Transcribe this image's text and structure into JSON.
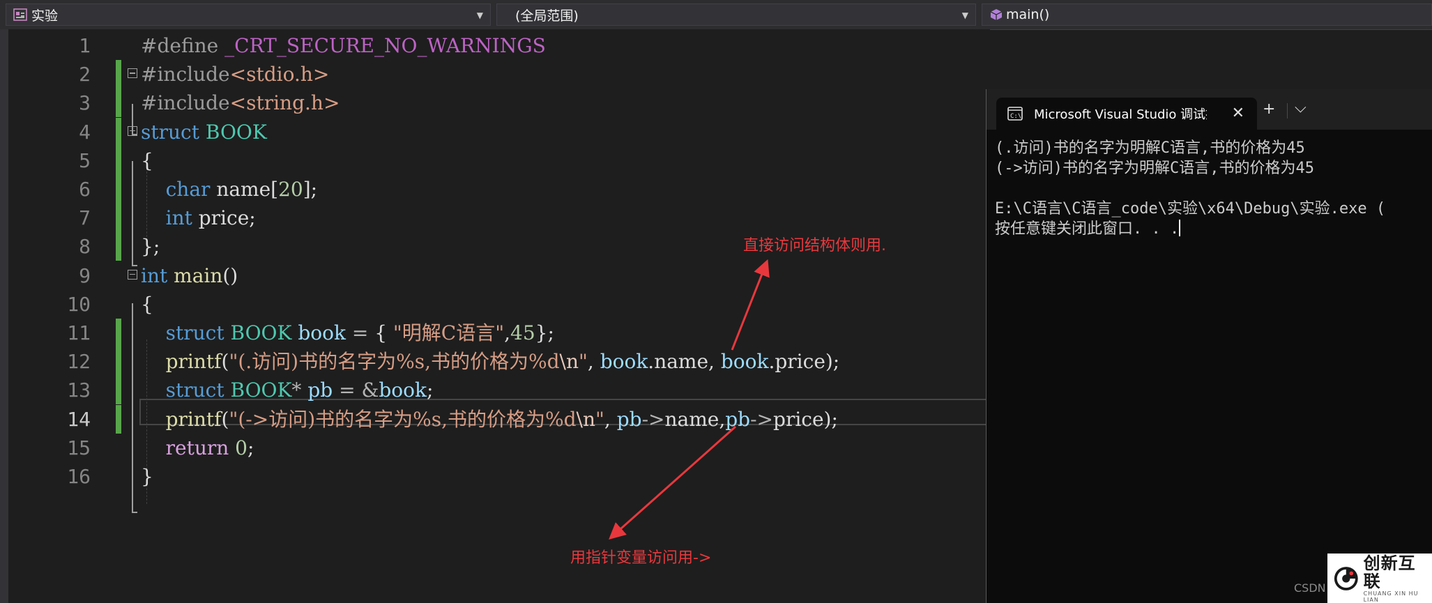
{
  "navbar": {
    "project": "实验",
    "scope": "(全局范围)",
    "member": "main()"
  },
  "editor": {
    "lines": [
      {
        "n": "1",
        "tokens": [
          [
            "pp",
            "#define "
          ],
          [
            "macro",
            "_CRT_SECURE_NO_WARNINGS"
          ]
        ]
      },
      {
        "n": "2",
        "tokens": [
          [
            "pp",
            "#include"
          ],
          [
            "inc",
            "<stdio.h>"
          ]
        ]
      },
      {
        "n": "3",
        "tokens": [
          [
            "pp",
            "#include"
          ],
          [
            "inc",
            "<string.h>"
          ]
        ]
      },
      {
        "n": "4",
        "tokens": [
          [
            "kw",
            "struct "
          ],
          [
            "type",
            "BOOK"
          ]
        ]
      },
      {
        "n": "5",
        "tokens": [
          [
            "pn",
            "{"
          ]
        ]
      },
      {
        "n": "6",
        "tokens": [
          [
            "pn",
            "    "
          ],
          [
            "kw",
            "char "
          ],
          [
            "pn",
            "name["
          ],
          [
            "num",
            "20"
          ],
          [
            "pn",
            "];"
          ]
        ]
      },
      {
        "n": "7",
        "tokens": [
          [
            "pn",
            "    "
          ],
          [
            "kw",
            "int "
          ],
          [
            "pn",
            "price;"
          ]
        ]
      },
      {
        "n": "8",
        "tokens": [
          [
            "pn",
            "};"
          ]
        ]
      },
      {
        "n": "9",
        "tokens": [
          [
            "kw",
            "int "
          ],
          [
            "fn",
            "main"
          ],
          [
            "pn",
            "()"
          ]
        ]
      },
      {
        "n": "10",
        "tokens": [
          [
            "pn",
            "{"
          ]
        ]
      },
      {
        "n": "11",
        "tokens": [
          [
            "pn",
            "    "
          ],
          [
            "kw",
            "struct "
          ],
          [
            "type",
            "BOOK "
          ],
          [
            "var",
            "book "
          ],
          [
            "op",
            "= "
          ],
          [
            "pn",
            "{ "
          ],
          [
            "str",
            "\"明解C语言\""
          ],
          [
            "pn",
            ","
          ],
          [
            "num",
            "45"
          ],
          [
            "pn",
            "};"
          ]
        ]
      },
      {
        "n": "12",
        "tokens": [
          [
            "pn",
            "    "
          ],
          [
            "fn",
            "printf"
          ],
          [
            "pn",
            "("
          ],
          [
            "str",
            "\"(.访问)书的名字为%s,书的价格为%d"
          ],
          [
            "esc",
            "\\n"
          ],
          [
            "str",
            "\""
          ],
          [
            "pn",
            ", "
          ],
          [
            "var",
            "book"
          ],
          [
            "pn",
            ".name, "
          ],
          [
            "var",
            "book"
          ],
          [
            "pn",
            ".price);"
          ]
        ]
      },
      {
        "n": "13",
        "tokens": [
          [
            "pn",
            "    "
          ],
          [
            "kw",
            "struct "
          ],
          [
            "type",
            "BOOK"
          ],
          [
            "op",
            "* "
          ],
          [
            "var",
            "pb "
          ],
          [
            "op",
            "= &"
          ],
          [
            "var",
            "book"
          ],
          [
            "pn",
            ";"
          ]
        ]
      },
      {
        "n": "14",
        "tokens": [
          [
            "pn",
            "    "
          ],
          [
            "fn",
            "printf"
          ],
          [
            "pn",
            "("
          ],
          [
            "str",
            "\"(->访问)书的名字为%s,书的价格为%d"
          ],
          [
            "esc",
            "\\n"
          ],
          [
            "str",
            "\""
          ],
          [
            "pn",
            ", "
          ],
          [
            "var",
            "pb"
          ],
          [
            "op",
            "->"
          ],
          [
            "pn",
            "name,"
          ],
          [
            "var",
            "pb"
          ],
          [
            "op",
            "->"
          ],
          [
            "pn",
            "price);"
          ]
        ]
      },
      {
        "n": "15",
        "tokens": [
          [
            "pn",
            "    "
          ],
          [
            "ctl",
            "return "
          ],
          [
            "num",
            "0"
          ],
          [
            "pn",
            ";"
          ]
        ]
      },
      {
        "n": "16",
        "tokens": [
          [
            "pn",
            "}"
          ]
        ]
      }
    ],
    "current_line": "14",
    "changed_lines": [
      "2",
      "3",
      "4",
      "5",
      "6",
      "7",
      "8",
      "11",
      "12",
      "13",
      "14"
    ],
    "fold_lines": [
      "2",
      "4",
      "9"
    ]
  },
  "annotations": {
    "direct": "直接访问结构体则用.",
    "pointer": "用指针变量访问用->"
  },
  "console": {
    "tab_title": "Microsoft Visual Studio 调试控制台",
    "new_tab": "+",
    "dropdown": "⌵",
    "close": "✕",
    "output": [
      "(.访问)书的名字为明解C语言,书的价格为45",
      "(->访问)书的名字为明解C语言,书的价格为45",
      "",
      "E:\\C语言\\C语言_code\\实验\\x64\\Debug\\实验.exe (",
      "按任意键关闭此窗口. . ."
    ]
  },
  "watermark": {
    "csdn": "CSDN",
    "brand_cn": "创新互联",
    "brand_en": "CHUANG XIN HU LIAN"
  },
  "colors": {
    "background": "#1e1e1e",
    "change_bar": "#57a64a",
    "annotation": "#e8383d",
    "keyword": "#569cd6",
    "type": "#4ec9b0",
    "string": "#d69d85"
  }
}
